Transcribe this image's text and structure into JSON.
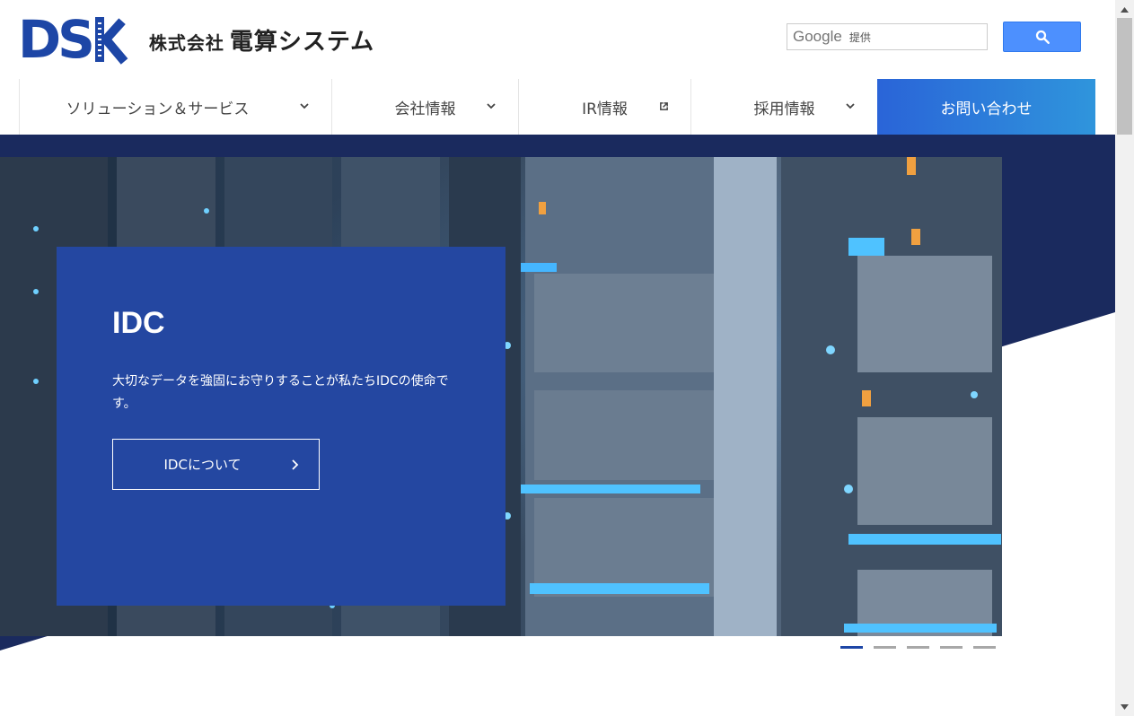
{
  "header": {
    "logo_mark": "DS",
    "logo_company_prefix": "株式会社",
    "logo_company_name": "電算システム",
    "search_brand": "Google",
    "search_provided": "提供"
  },
  "nav": {
    "items": [
      {
        "label": "ソリューション＆サービス"
      },
      {
        "label": "会社情報"
      },
      {
        "label": "IR情報"
      },
      {
        "label": "採用情報"
      },
      {
        "label": "お問い合わせ"
      }
    ]
  },
  "hero": {
    "title": "IDC",
    "description": "大切なデータを強固にお守りすることが私たちIDCの使命です。",
    "button_label": "IDCについて",
    "slides": 5,
    "active_slide": 1
  },
  "colors": {
    "brand_blue": "#1d46a6",
    "panel_blue": "#2447a1",
    "navy": "#1a2a5e"
  }
}
